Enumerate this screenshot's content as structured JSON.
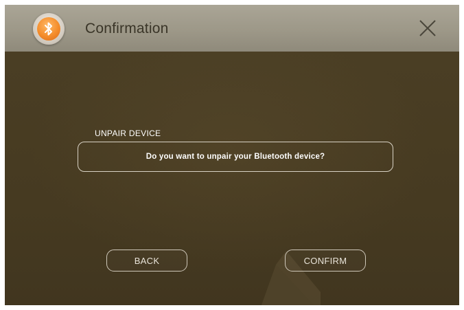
{
  "header": {
    "title": "Confirmation",
    "app_icon": "bluetooth-icon",
    "close_icon": "close-icon"
  },
  "dialog": {
    "section_label": "UNPAIR DEVICE",
    "message": "Do you want to unpair your Bluetooth device?",
    "back_label": "BACK",
    "confirm_label": "CONFIRM"
  },
  "colors": {
    "header_bg": "#9d9888",
    "content_bg": "#463a21",
    "accent_orange": "#f48d2b",
    "outline": "#d9d3c6"
  }
}
